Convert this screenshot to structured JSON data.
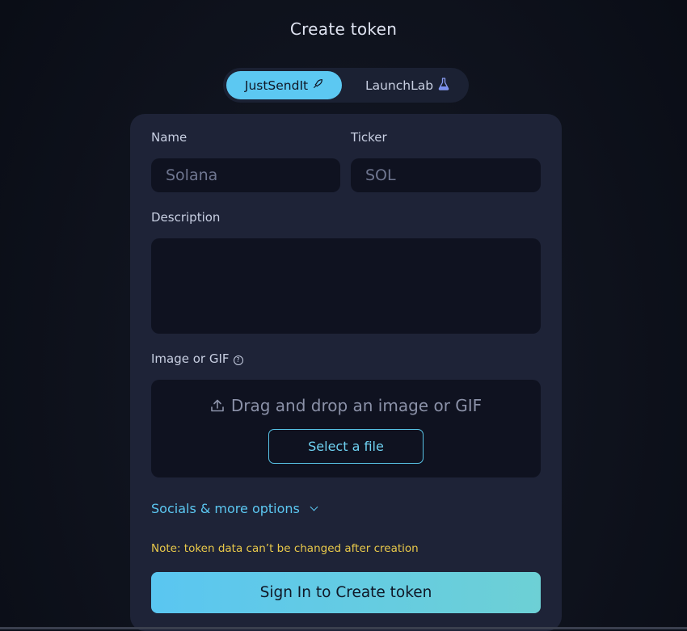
{
  "header": {
    "title": "Create token"
  },
  "mode_toggle": {
    "options": [
      {
        "label": "JustSendIt",
        "icon": "rocket-icon",
        "active": true
      },
      {
        "label": "LaunchLab",
        "icon": "flask-icon",
        "active": false
      }
    ]
  },
  "form": {
    "name": {
      "label": "Name",
      "placeholder": "Solana",
      "value": ""
    },
    "ticker": {
      "label": "Ticker",
      "placeholder": "SOL",
      "value": ""
    },
    "description": {
      "label": "Description",
      "value": ""
    },
    "image": {
      "label": "Image or GIF",
      "drop_text": "Drag and drop an image or GIF",
      "select_label": "Select a file"
    },
    "socials_label": "Socials & more options",
    "note": "Note: token data can’t be changed after creation",
    "submit_label": "Sign In to Create token"
  },
  "colors": {
    "accent": "#5cc8f2",
    "note": "#e9c94a",
    "card": "#1e2337",
    "input": "#0f1220"
  }
}
